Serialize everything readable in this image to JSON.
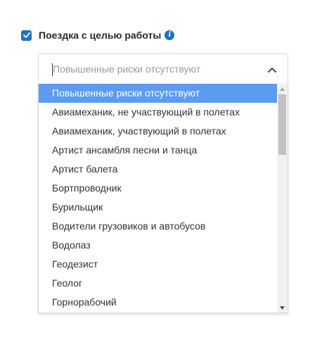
{
  "checkbox": {
    "checked": true,
    "label": "Поездка с целью работы",
    "info_icon": "info-icon"
  },
  "select": {
    "placeholder": "Повышенные риски отсутствуют",
    "value": "",
    "toggle_icon": "chevron-up-icon"
  },
  "dropdown": {
    "selected_index": 0,
    "options": [
      "Повышенные риски отсутствуют",
      "Авиамеханик, не участвующий в полетах",
      "Авиамеханик, участвующий в полетах",
      "Артист ансамбля песни и танца",
      "Артист балета",
      "Бортпроводник",
      "Бурильщик",
      "Водители грузовиков и автобусов",
      "Водолаз",
      "Геодезист",
      "Геолог",
      "Горнорабочий"
    ]
  },
  "colors": {
    "accent": "#1a73c9",
    "highlight": "#5b9cf0",
    "border": "#d9d9d9",
    "placeholder": "#9a9a9a"
  }
}
